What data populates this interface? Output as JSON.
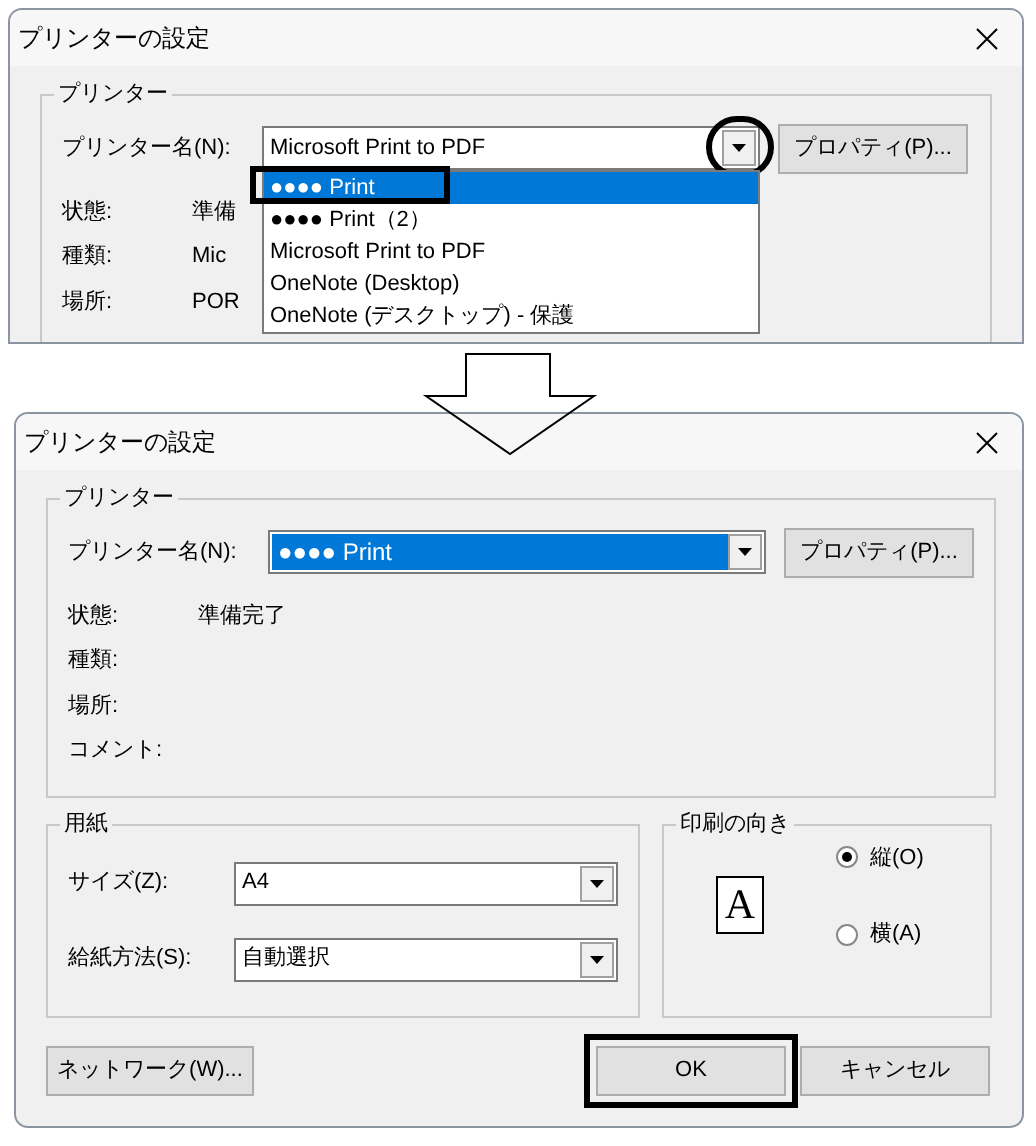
{
  "dialogs": [
    {
      "title": "プリンターの設定",
      "printer": {
        "group_label": "プリンター",
        "name_label": "プリンター名(N):",
        "name_value": "Microsoft Print to PDF",
        "name_selected": false,
        "dropdown_circled": true,
        "properties_button": "プロパティ(P)...",
        "details": [
          {
            "label": "状態:",
            "value": "準備"
          },
          {
            "label": "種類:",
            "value": "Mic"
          },
          {
            "label": "場所:",
            "value": "POR"
          }
        ],
        "options": [
          {
            "label": "●●●● Print",
            "selected": true,
            "boxed": true
          },
          {
            "label": "●●●● Print（2）",
            "selected": false,
            "boxed": false
          },
          {
            "label": "Microsoft Print to PDF",
            "selected": false,
            "boxed": false
          },
          {
            "label": "OneNote (Desktop)",
            "selected": false,
            "boxed": false
          },
          {
            "label": "OneNote (デスクトップ) - 保護",
            "selected": false,
            "boxed": false
          }
        ]
      }
    },
    {
      "title": "プリンターの設定",
      "printer": {
        "group_label": "プリンター",
        "name_label": "プリンター名(N):",
        "name_value": "●●●● Print",
        "name_selected": true,
        "dropdown_circled": false,
        "properties_button": "プロパティ(P)...",
        "details": [
          {
            "label": "状態:",
            "value": "準備完了"
          },
          {
            "label": "種類:"
          },
          {
            "label": "場所:"
          },
          {
            "label": "コメント:"
          }
        ]
      },
      "paper": {
        "group_label": "用紙",
        "fields": [
          {
            "label": "サイズ(Z):",
            "value": "A4"
          },
          {
            "label": "給紙方法(S):",
            "value": "自動選択"
          }
        ]
      },
      "orientation": {
        "group_label": "印刷の向き",
        "icon_letter": "A",
        "options": [
          {
            "label": "縦(O)",
            "selected": true
          },
          {
            "label": "横(A)",
            "selected": false
          }
        ]
      },
      "buttons": [
        {
          "label": "ネットワーク(W)...",
          "boxed": false
        },
        {
          "label": "OK",
          "boxed": true
        },
        {
          "label": "キャンセル",
          "boxed": false
        }
      ]
    }
  ]
}
